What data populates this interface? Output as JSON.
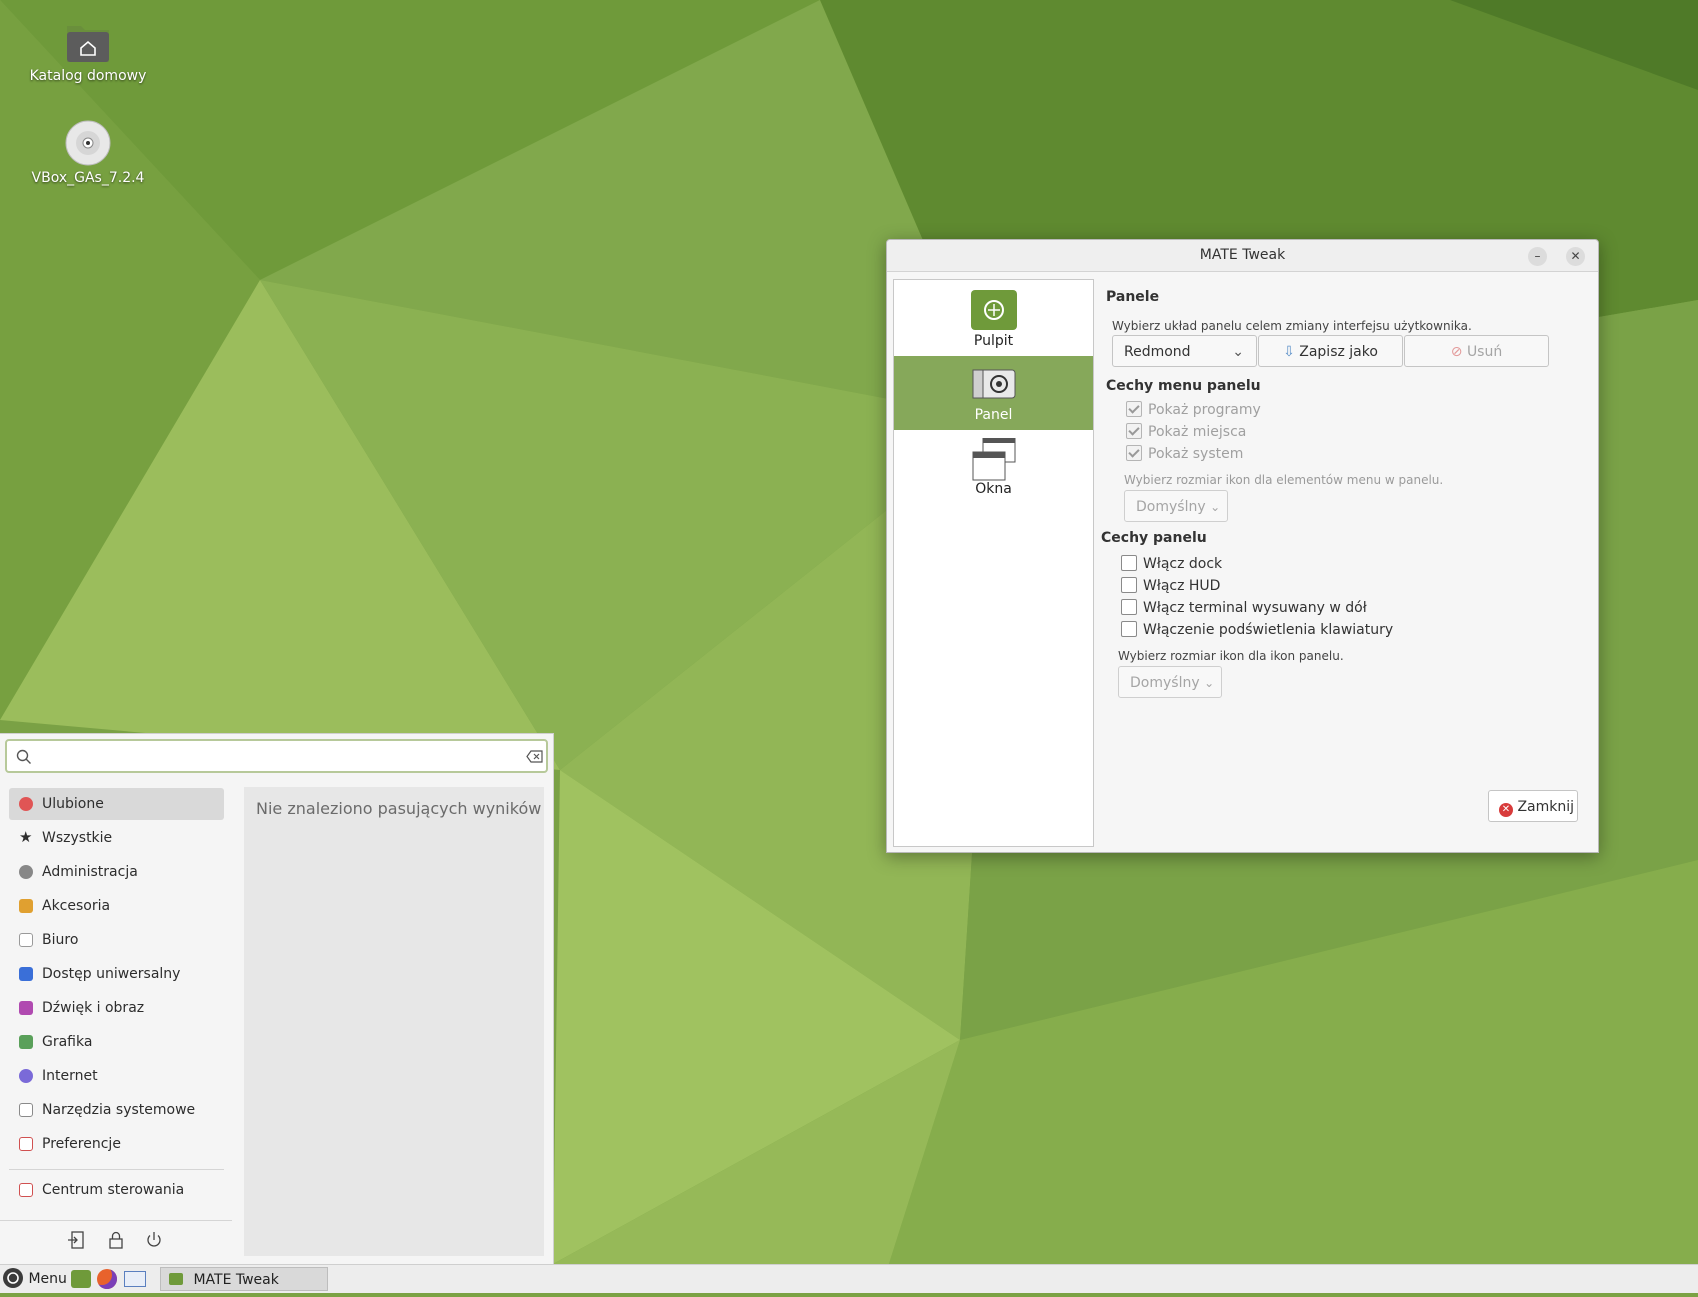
{
  "desktop": {
    "icons": [
      {
        "label": "Katalog domowy",
        "icon": "home-folder-icon"
      },
      {
        "label": "VBox_GAs_7.2.4",
        "icon": "optical-disc-icon"
      }
    ]
  },
  "window": {
    "title": "MATE Tweak",
    "sidebar": [
      {
        "label": "Pulpit",
        "icon": "desktop-icon",
        "active": false
      },
      {
        "label": "Panel",
        "icon": "panel-icon",
        "active": true
      },
      {
        "label": "Okna",
        "icon": "windows-icon",
        "active": false
      }
    ],
    "panels_section": {
      "heading": "Panele",
      "description": "Wybierz układ panelu celem zmiany interfejsu użytkownika.",
      "layout_value": "Redmond",
      "save_as_label": "Zapisz jako",
      "delete_label": "Usuń"
    },
    "menu_features": {
      "heading": "Cechy menu panelu",
      "options": [
        {
          "label": "Pokaż programy",
          "checked": true,
          "enabled": false
        },
        {
          "label": "Pokaż miejsca",
          "checked": true,
          "enabled": false
        },
        {
          "label": "Pokaż system",
          "checked": true,
          "enabled": false
        }
      ],
      "icon_size_label": "Wybierz rozmiar ikon dla elementów menu w panelu.",
      "icon_size_value": "Domyślny"
    },
    "panel_features": {
      "heading": "Cechy panelu",
      "options": [
        {
          "label": "Włącz dock",
          "checked": false
        },
        {
          "label": "Włącz HUD",
          "checked": false
        },
        {
          "label": "Włącz terminal wysuwany w dół",
          "checked": false
        },
        {
          "label": "Włączenie podświetlenia klawiatury",
          "checked": false
        }
      ],
      "icon_size_label": "Wybierz rozmiar ikon dla ikon panelu.",
      "icon_size_value": "Domyślny"
    },
    "close_label": "Zamknij"
  },
  "start_menu": {
    "search_placeholder": "",
    "categories": [
      {
        "label": "Ulubione",
        "color": "#e05555"
      },
      {
        "label": "Wszystkie",
        "color": "#333333"
      },
      {
        "label": "Administracja",
        "color": "#888888"
      },
      {
        "label": "Akcesoria",
        "color": "#e0a030"
      },
      {
        "label": "Biuro",
        "color": "#9a9a9a"
      },
      {
        "label": "Dostęp uniwersalny",
        "color": "#3a6fd8"
      },
      {
        "label": "Dźwięk i obraz",
        "color": "#b04ab0"
      },
      {
        "label": "Grafika",
        "color": "#5aa05a"
      },
      {
        "label": "Internet",
        "color": "#7a6ad8"
      },
      {
        "label": "Narzędzia systemowe",
        "color": "#8a8a8a"
      },
      {
        "label": "Preferencje",
        "color": "#d05050"
      }
    ],
    "control_center": {
      "label": "Centrum sterowania",
      "color": "#d05050"
    },
    "no_results": "Nie znaleziono pasujących wyników"
  },
  "taskbar": {
    "menu_label": "Menu",
    "task_label": "MATE Tweak"
  },
  "colors": {
    "accent": "#86a85a",
    "wallpaper": "#7ba244"
  }
}
